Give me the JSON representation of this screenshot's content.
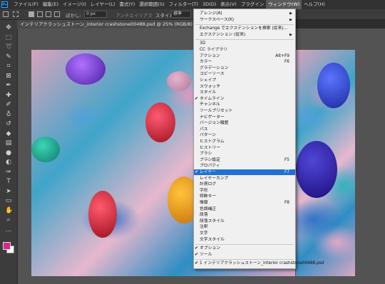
{
  "app": {
    "logo": "Ps"
  },
  "menubar": [
    {
      "label": "ファイル(F)",
      "active": false
    },
    {
      "label": "編集(E)",
      "active": false
    },
    {
      "label": "イメージ(I)",
      "active": false
    },
    {
      "label": "レイヤー(L)",
      "active": false
    },
    {
      "label": "書式(Y)",
      "active": false
    },
    {
      "label": "選択範囲(S)",
      "active": false
    },
    {
      "label": "フィルター(T)",
      "active": false
    },
    {
      "label": "3D(D)",
      "active": false
    },
    {
      "label": "表示(V)",
      "active": false
    },
    {
      "label": "プラグイン",
      "active": false
    },
    {
      "label": "ウィンドウ(W)",
      "active": true
    },
    {
      "label": "ヘルプ(H)",
      "active": false
    }
  ],
  "options": {
    "feather_label": "ぼかし:",
    "feather_value": "0 px",
    "antialias_label": "アンチエイリアス",
    "style_label": "スタイル:",
    "style_value": "標準"
  },
  "document_tab": {
    "title": "インテリアクラッシュストーン_interior crashstone00488.psd @ 25% (RGB/8) *"
  },
  "window_menu": {
    "items": [
      {
        "label": "アレンジ(A)",
        "shortcut": "",
        "submenu": true,
        "checked": false,
        "selected": false,
        "sep_after": false
      },
      {
        "label": "ワークスペース(K)",
        "shortcut": "",
        "submenu": true,
        "checked": false,
        "selected": false,
        "sep_after": true
      },
      {
        "label": "Exchange でエクステンションを検索 (従来)...",
        "shortcut": "",
        "submenu": false,
        "checked": false,
        "selected": false,
        "sep_after": false
      },
      {
        "label": "エクステンション (従来)",
        "shortcut": "",
        "submenu": true,
        "checked": false,
        "selected": false,
        "sep_after": true
      },
      {
        "label": "3D",
        "shortcut": "",
        "submenu": false,
        "checked": false,
        "selected": false,
        "sep_after": false
      },
      {
        "label": "CC ライブラリ",
        "shortcut": "",
        "submenu": false,
        "checked": false,
        "selected": false,
        "sep_after": false
      },
      {
        "label": "アクション",
        "shortcut": "Alt+F9",
        "submenu": false,
        "checked": false,
        "selected": false,
        "sep_after": false
      },
      {
        "label": "カラー",
        "shortcut": "F6",
        "submenu": false,
        "checked": false,
        "selected": false,
        "sep_after": false
      },
      {
        "label": "グラデーション",
        "shortcut": "",
        "submenu": false,
        "checked": false,
        "selected": false,
        "sep_after": false
      },
      {
        "label": "コピーソース",
        "shortcut": "",
        "submenu": false,
        "checked": false,
        "selected": false,
        "sep_after": false
      },
      {
        "label": "シェイプ",
        "shortcut": "",
        "submenu": false,
        "checked": false,
        "selected": false,
        "sep_after": false
      },
      {
        "label": "スウォッチ",
        "shortcut": "",
        "submenu": false,
        "checked": false,
        "selected": false,
        "sep_after": false
      },
      {
        "label": "スタイル",
        "shortcut": "",
        "submenu": false,
        "checked": false,
        "selected": false,
        "sep_after": false
      },
      {
        "label": "タイムライン",
        "shortcut": "",
        "submenu": false,
        "checked": true,
        "selected": false,
        "sep_after": false
      },
      {
        "label": "チャンネル",
        "shortcut": "",
        "submenu": false,
        "checked": false,
        "selected": false,
        "sep_after": false
      },
      {
        "label": "ツールプリセット",
        "shortcut": "",
        "submenu": false,
        "checked": false,
        "selected": false,
        "sep_after": false
      },
      {
        "label": "ナビゲーター",
        "shortcut": "",
        "submenu": false,
        "checked": false,
        "selected": false,
        "sep_after": false
      },
      {
        "label": "バージョン履歴",
        "shortcut": "",
        "submenu": false,
        "checked": false,
        "selected": false,
        "sep_after": false
      },
      {
        "label": "パス",
        "shortcut": "",
        "submenu": false,
        "checked": false,
        "selected": false,
        "sep_after": false
      },
      {
        "label": "パターン",
        "shortcut": "",
        "submenu": false,
        "checked": false,
        "selected": false,
        "sep_after": false
      },
      {
        "label": "ヒストグラム",
        "shortcut": "",
        "submenu": false,
        "checked": false,
        "selected": false,
        "sep_after": false
      },
      {
        "label": "ヒストリー",
        "shortcut": "",
        "submenu": false,
        "checked": false,
        "selected": false,
        "sep_after": false
      },
      {
        "label": "ブラシ",
        "shortcut": "",
        "submenu": false,
        "checked": false,
        "selected": false,
        "sep_after": false
      },
      {
        "label": "ブラシ設定",
        "shortcut": "F5",
        "submenu": false,
        "checked": false,
        "selected": false,
        "sep_after": false
      },
      {
        "label": "プロパティ",
        "shortcut": "",
        "submenu": false,
        "checked": false,
        "selected": false,
        "sep_after": false
      },
      {
        "label": "レイヤー",
        "shortcut": "F7",
        "submenu": false,
        "checked": true,
        "selected": true,
        "sep_after": false
      },
      {
        "label": "レイヤーカンプ",
        "shortcut": "",
        "submenu": false,
        "checked": false,
        "selected": false,
        "sep_after": false
      },
      {
        "label": "計測ログ",
        "shortcut": "",
        "submenu": false,
        "checked": false,
        "selected": false,
        "sep_after": false
      },
      {
        "label": "字形",
        "shortcut": "",
        "submenu": false,
        "checked": false,
        "selected": false,
        "sep_after": false
      },
      {
        "label": "修飾キー",
        "shortcut": "",
        "submenu": false,
        "checked": false,
        "selected": false,
        "sep_after": false
      },
      {
        "label": "情報",
        "shortcut": "F8",
        "submenu": false,
        "checked": false,
        "selected": false,
        "sep_after": false
      },
      {
        "label": "色調補正",
        "shortcut": "",
        "submenu": false,
        "checked": false,
        "selected": false,
        "sep_after": false
      },
      {
        "label": "段落",
        "shortcut": "",
        "submenu": false,
        "checked": false,
        "selected": false,
        "sep_after": false
      },
      {
        "label": "段落スタイル",
        "shortcut": "",
        "submenu": false,
        "checked": false,
        "selected": false,
        "sep_after": false
      },
      {
        "label": "注釈",
        "shortcut": "",
        "submenu": false,
        "checked": false,
        "selected": false,
        "sep_after": false
      },
      {
        "label": "文字",
        "shortcut": "",
        "submenu": false,
        "checked": false,
        "selected": false,
        "sep_after": false
      },
      {
        "label": "文字スタイル",
        "shortcut": "",
        "submenu": false,
        "checked": false,
        "selected": false,
        "sep_after": true
      },
      {
        "label": "オプション",
        "shortcut": "",
        "submenu": false,
        "checked": true,
        "selected": false,
        "sep_after": false
      },
      {
        "label": "ツール",
        "shortcut": "",
        "submenu": false,
        "checked": true,
        "selected": false,
        "sep_after": true
      },
      {
        "label": "1 インテリアクラッシュストーン_interior crashstone00488.psd",
        "shortcut": "",
        "submenu": false,
        "checked": true,
        "selected": false,
        "sep_after": false
      }
    ]
  },
  "tools": [
    "move-icon",
    "marquee-icon",
    "lasso-icon",
    "quick-select-icon",
    "crop-icon",
    "frame-icon",
    "eyedropper-icon",
    "healing-icon",
    "brush-icon",
    "stamp-icon",
    "history-brush-icon",
    "eraser-icon",
    "gradient-icon",
    "blur-icon",
    "dodge-icon",
    "pen-icon",
    "type-icon",
    "path-select-icon",
    "rectangle-icon",
    "hand-icon",
    "zoom-icon",
    "more-icon"
  ],
  "colors": {
    "foreground": "#e0228f",
    "background": "#ffffff",
    "accent": "#1f6fd6"
  }
}
